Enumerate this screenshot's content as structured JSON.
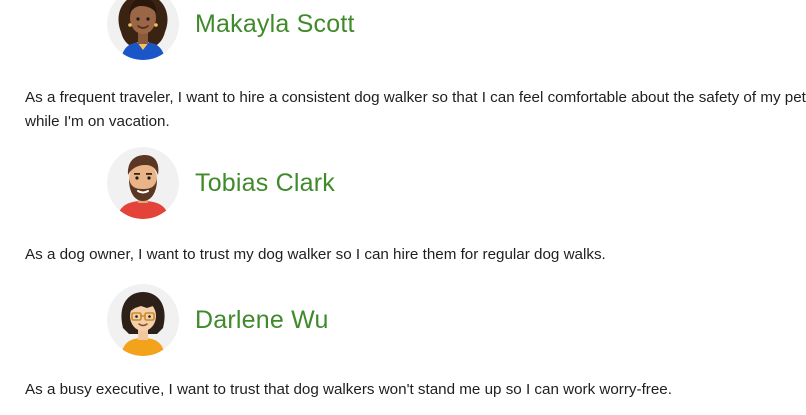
{
  "personas": [
    {
      "name": "Makayla Scott",
      "story": "As a frequent traveler, I want to hire a consistent dog walker so that I can feel comfortable about the safety of my pets while I'm on vacation.",
      "avatar_icon": "woman-curly-hair-avatar-icon"
    },
    {
      "name": "Tobias Clark",
      "story": "As a dog owner, I want to trust my dog walker so I can hire them for regular dog walks.",
      "avatar_icon": "bearded-man-avatar-icon"
    },
    {
      "name": "Darlene Wu",
      "story": "As a busy executive, I want to trust that dog walkers won't stand me up so I can work worry-free.",
      "avatar_icon": "woman-glasses-avatar-icon"
    }
  ],
  "colors": {
    "name_green": "#3f8a2a",
    "text": "#1f1f1f",
    "avatar_bg": "#f1f1f1"
  }
}
